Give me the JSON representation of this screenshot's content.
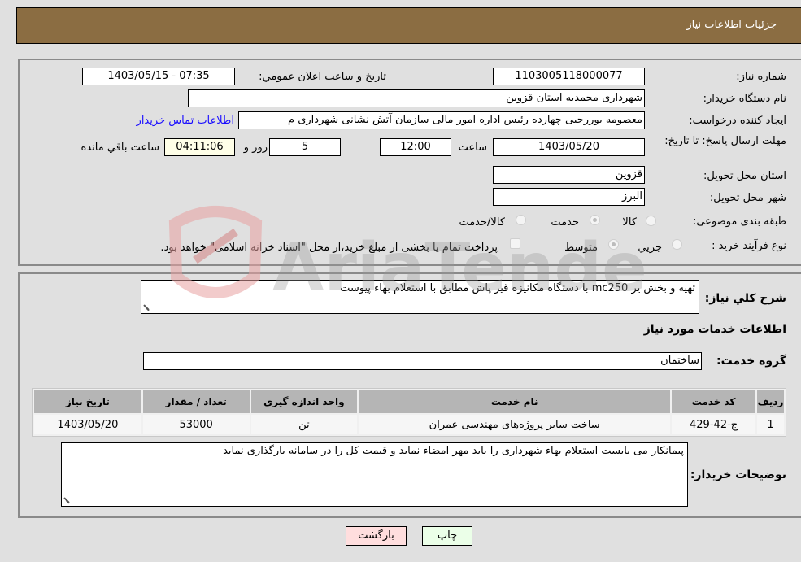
{
  "header": {
    "title": "جزئیات اطلاعات نیاز"
  },
  "details": {
    "need_number": {
      "label": "شماره نیاز:",
      "value": "1103005118000077"
    },
    "announce_datetime": {
      "label": "تاریخ و ساعت اعلان عمومي:",
      "value": "1403/05/15 - 07:35"
    },
    "buyer_org": {
      "label": "نام دستگاه خريدار:",
      "value": "شهرداری محمدیه استان قزوین"
    },
    "requester": {
      "label": "ایجاد کننده درخواست:",
      "value": "معصومه بوررجبی چهارده رئیس اداره امور مالی سازمان آتش نشانی شهرداری م"
    },
    "buyer_contact_link": "اطلاعات تماس خريدار",
    "deadline": {
      "label": "مهلت ارسال پاسخ: تا تاريخ:",
      "date": "1403/05/20",
      "time_label": "ساعت",
      "time": "12:00",
      "days": "5",
      "days_label": "روز و",
      "remaining": "04:11:06",
      "remaining_label": "ساعت باقي مانده"
    },
    "delivery_province": {
      "label": "استان محل تحویل:",
      "value": "قزوین"
    },
    "delivery_city": {
      "label": "شهر محل تحویل:",
      "value": "البرز"
    },
    "category": {
      "label": "طبقه بندی موضوعی:",
      "options": [
        {
          "label": "کالا",
          "checked": false
        },
        {
          "label": "خدمت",
          "checked": true
        },
        {
          "label": "کالا/خدمت",
          "checked": false
        }
      ]
    },
    "purchase_process": {
      "label": "نوع فرآیند خرید :",
      "options": [
        {
          "label": "جزيي",
          "checked": false
        },
        {
          "label": "متوسط",
          "checked": true
        }
      ],
      "treasury_note": "پرداخت تمام یا بخشی از مبلغ خرید،از محل \"اسناد خزانه اسلامی\" خواهد بود.",
      "treasury_checked": false
    }
  },
  "need_description": {
    "label": "شرح کلي نياز:",
    "value": "تهیه و بخش یر mc250 با دستگاه مکانیزه قیر پاش مطابق با استعلام بهاء پیوست"
  },
  "services_info": {
    "title": "اطلاعات خدمات مورد نياز",
    "group_label": "گروه خدمت:",
    "group_value": "ساختمان",
    "table": {
      "headers": [
        "رديف",
        "کد خدمت",
        "نام خدمت",
        "واحد اندازه گیری",
        "تعداد / مقدار",
        "تاریخ نیاز"
      ],
      "rows": [
        [
          "1",
          "ج-42-429",
          "ساخت سایر پروژه‌های مهندسی عمران",
          "تن",
          "53000",
          "1403/05/20"
        ]
      ]
    }
  },
  "buyer_notes": {
    "label": "توضیحات خریدار:",
    "value": "پیمانکار می بایست استعلام بهاء شهرداری را باید مهر امضاء نماید و قیمت کل را در سامانه بارگذاری نماید"
  },
  "buttons": {
    "print": "چاپ",
    "back": "بازگشت"
  },
  "watermark": {
    "text": "AriaTender.neT"
  }
}
